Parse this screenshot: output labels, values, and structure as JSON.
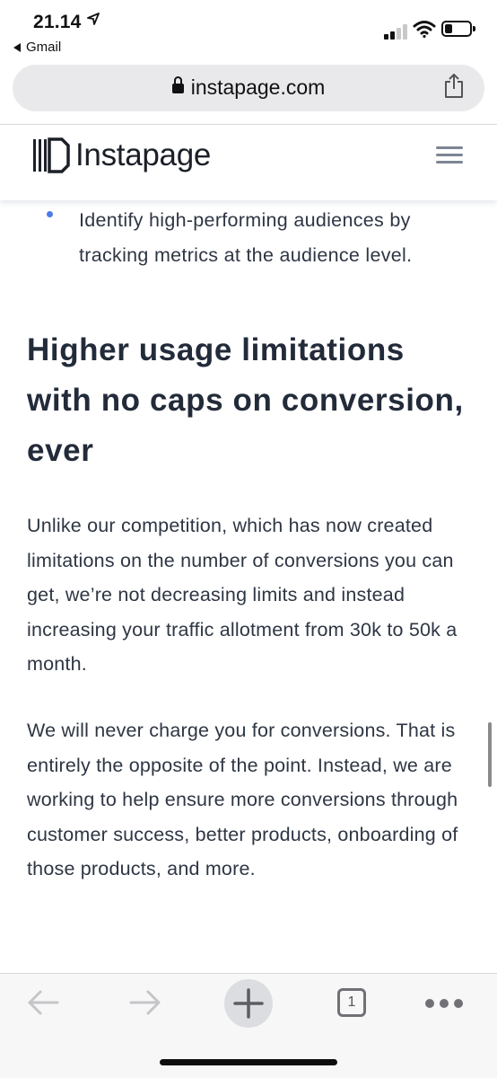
{
  "status_bar": {
    "time": "21.14",
    "back_app": "Gmail"
  },
  "browser": {
    "url": "instapage.com",
    "tab_count": "1"
  },
  "site": {
    "logo_text": "Instapage"
  },
  "content": {
    "bullet_text": "Identify high-performing audiences by tracking metrics at the audience level.",
    "heading": "Higher usage limitations with no caps on conversion, ever",
    "paragraph1": "Unlike our competition, which has now created limitations on the number of conversions you can get, we’re not decreasing limits and instead increasing your traffic allotment from 30k to 50k a month.",
    "paragraph2": "We will never charge you for conversions. That is entirely the opposite of the point. Instead, we are working to help ensure more conversions through customer success, better products, onboarding of those products, and more."
  },
  "icons": {
    "location": "location-arrow-icon",
    "signal": "cellular-signal-icon",
    "wifi": "wifi-icon",
    "battery": "battery-icon",
    "lock": "lock-icon",
    "share": "share-icon",
    "menu": "hamburger-menu-icon",
    "back": "back-arrow-icon",
    "forward": "forward-arrow-icon",
    "new_tab": "plus-icon",
    "tabs": "tabs-icon",
    "more": "more-icon"
  },
  "colors": {
    "accent_bullet": "#4a7bea",
    "heading": "#232b3a",
    "body_text": "#2e3644"
  }
}
